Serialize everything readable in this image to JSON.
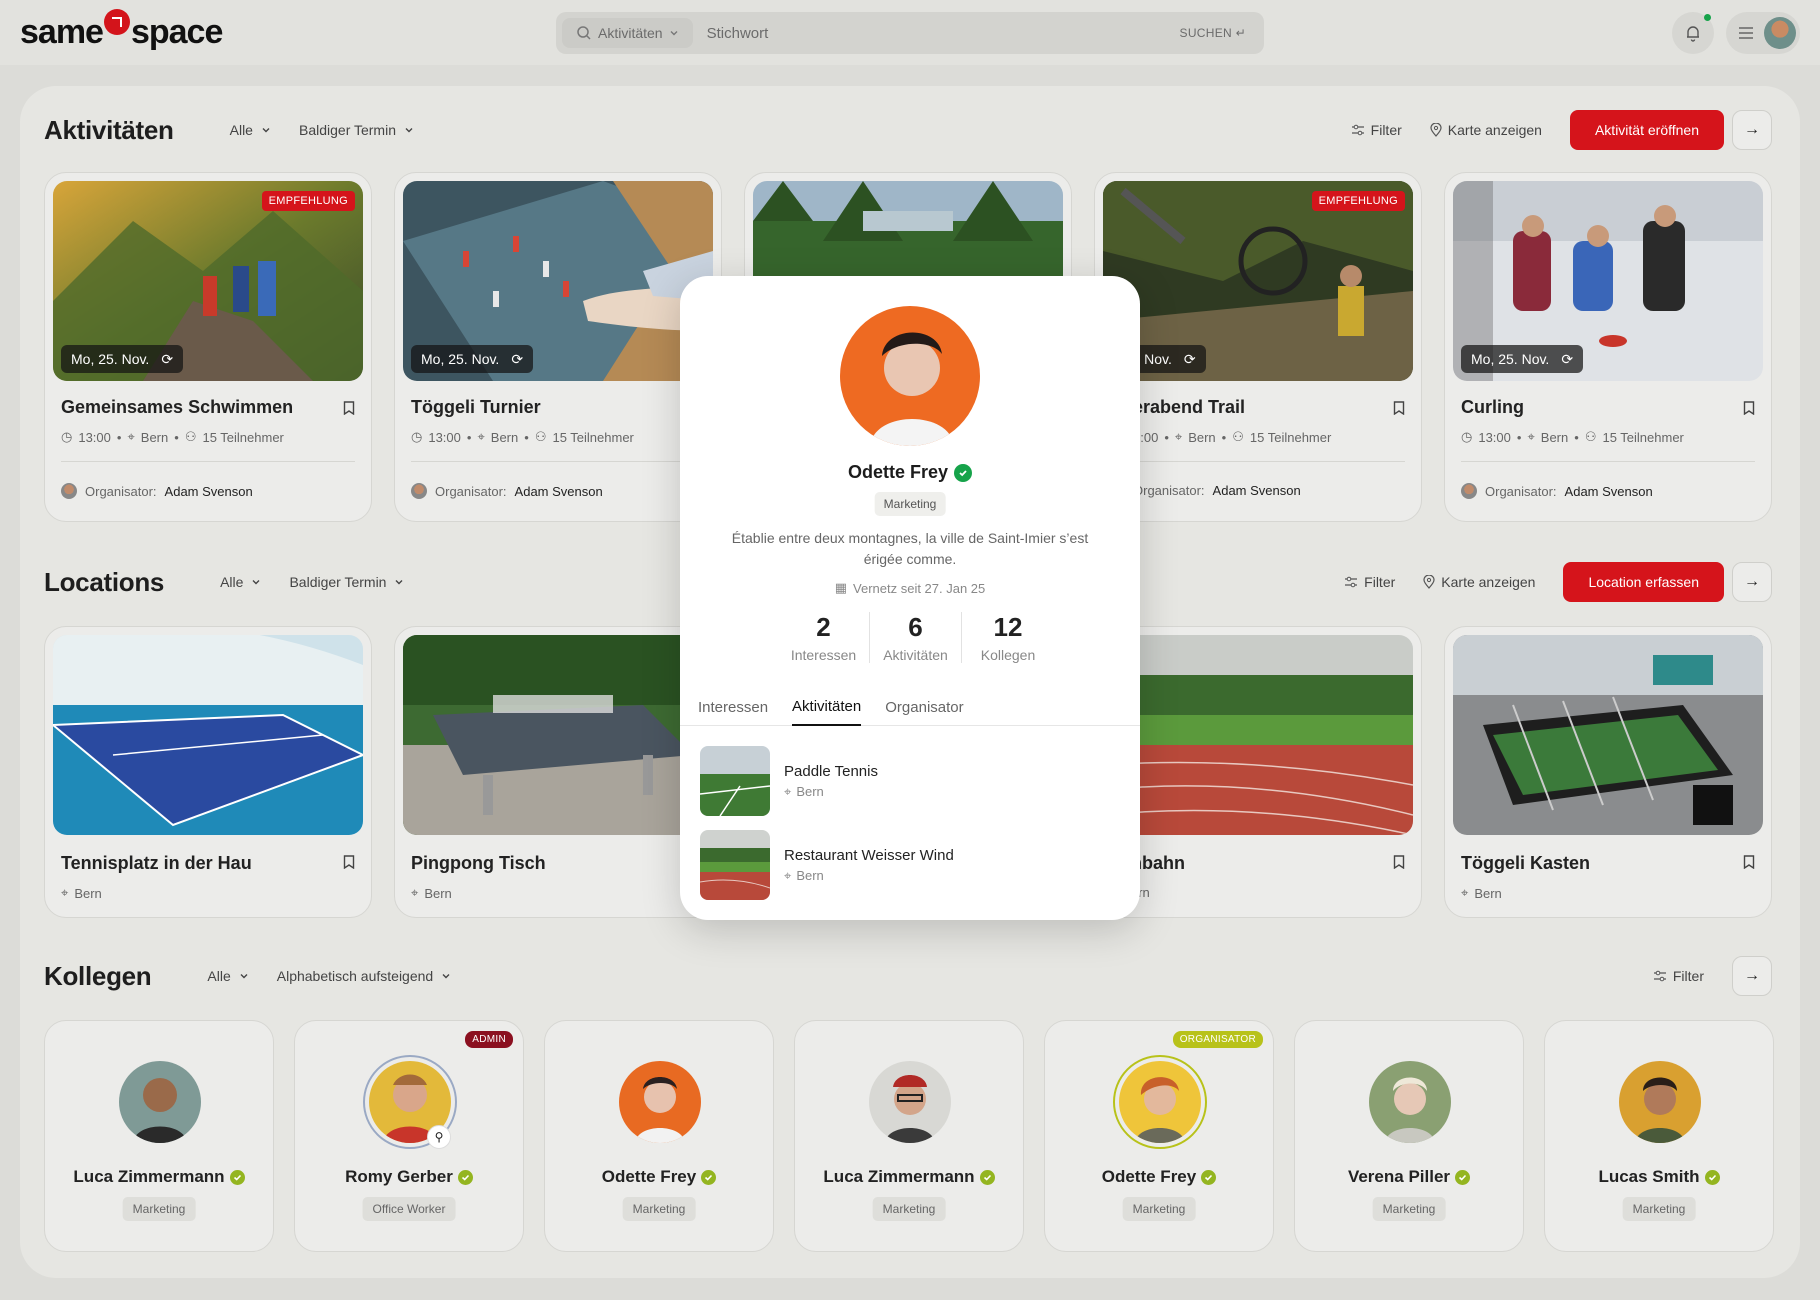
{
  "brand": {
    "part1": "same",
    "part2": "space"
  },
  "search": {
    "type_label": "Aktivitäten",
    "placeholder": "Stichwort",
    "submit": "SUCHEN ↵"
  },
  "sections": {
    "activities": {
      "title": "Aktivitäten",
      "filter_all": "Alle",
      "sort": "Baldiger Termin",
      "filter": "Filter",
      "map": "Karte anzeigen",
      "cta": "Aktivität eröffnen",
      "organizer_prefix": "Organisator:",
      "cards": [
        {
          "title": "Gemeinsames Schwimmen",
          "date": "Mo, 25. Nov.",
          "time": "13:00",
          "place": "Bern",
          "participants": "15 Teilnehmer",
          "organizer": "Adam Svenson",
          "badge": "EMPFEHLUNG"
        },
        {
          "title": "Töggeli Turnier",
          "date": "Mo, 25. Nov.",
          "time": "13:00",
          "place": "Bern",
          "participants": "15 Teilnehmer",
          "organizer": "Adam Svenson",
          "badge": ""
        },
        {
          "title": "",
          "date": "",
          "time": "",
          "place": "",
          "participants": "",
          "organizer": "",
          "badge": ""
        },
        {
          "title": "erabend Trail",
          "date": ", 25. Nov.",
          "time": "3:00",
          "place": "Bern",
          "participants": "15 Teilnehmer",
          "organizer": "Adam Svenson",
          "badge": "EMPFEHLUNG"
        },
        {
          "title": "Curling",
          "date": "Mo, 25. Nov.",
          "time": "13:00",
          "place": "Bern",
          "participants": "15 Teilnehmer",
          "organizer": "Adam Svenson",
          "badge": ""
        }
      ]
    },
    "locations": {
      "title": "Locations",
      "filter_all": "Alle",
      "sort": "Baldiger Termin",
      "filter": "Filter",
      "map": "Karte anzeigen",
      "cta": "Location erfassen",
      "cards": [
        {
          "title": "Tennisplatz in der Hau",
          "place": "Bern"
        },
        {
          "title": "Pingpong Tisch",
          "place": "Bern"
        },
        {
          "title": "",
          "place": ""
        },
        {
          "title": "nbahn",
          "place": "ern"
        },
        {
          "title": "Töggeli Kasten",
          "place": "Bern"
        }
      ]
    },
    "colleagues": {
      "title": "Kollegen",
      "filter_all": "Alle",
      "sort": "Alphabetisch aufsteigend",
      "filter": "Filter",
      "cards": [
        {
          "name": "Luca Zimmermann",
          "role": "Marketing",
          "tag": ""
        },
        {
          "name": "Romy Gerber",
          "role": "Office Worker",
          "tag": "ADMIN"
        },
        {
          "name": "Odette Frey",
          "role": "Marketing",
          "tag": ""
        },
        {
          "name": "Luca Zimmermann",
          "role": "Marketing",
          "tag": ""
        },
        {
          "name": "Odette Frey",
          "role": "Marketing",
          "tag": "ORGANISATOR"
        },
        {
          "name": "Verena Piller",
          "role": "Marketing",
          "tag": ""
        },
        {
          "name": "Lucas Smith",
          "role": "Marketing",
          "tag": ""
        }
      ]
    }
  },
  "profile": {
    "name": "Odette Frey",
    "role": "Marketing",
    "bio": "Établie entre deux montagnes, la ville de Saint-Imier s’est érigée comme.",
    "since": "Vernetz seit 27. Jan 25",
    "stats": [
      {
        "value": "2",
        "label": "Interessen"
      },
      {
        "value": "6",
        "label": "Aktivitäten"
      },
      {
        "value": "12",
        "label": "Kollegen"
      }
    ],
    "tabs": [
      "Interessen",
      "Aktivitäten",
      "Organisator"
    ],
    "active_tab": "Aktivitäten",
    "items": [
      {
        "title": "Paddle Tennis",
        "place": "Bern"
      },
      {
        "title": "Restaurant Weisser Wind",
        "place": "Bern"
      }
    ]
  },
  "colors": {
    "accent": "#d5141b",
    "verified": "#94b520",
    "admin": "#8b1020",
    "organizer": "#b8c21a"
  }
}
